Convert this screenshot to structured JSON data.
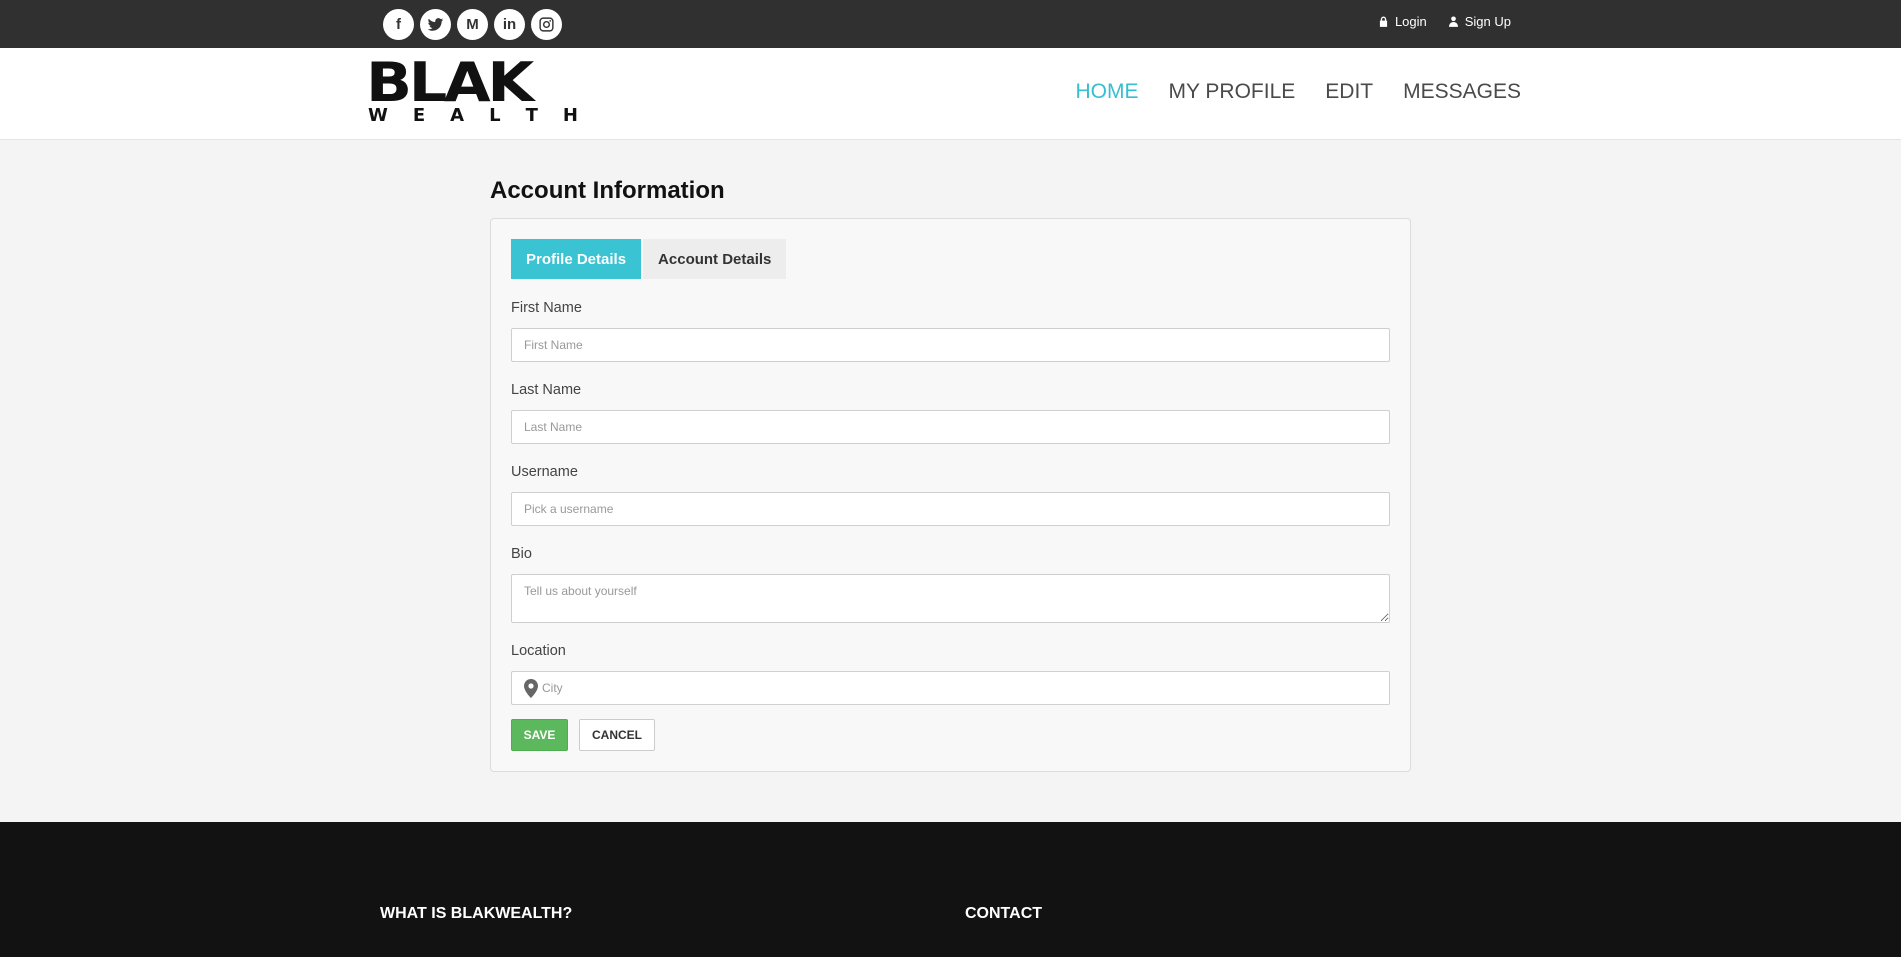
{
  "topbar": {
    "social": [
      {
        "icon": "facebook-icon",
        "glyph": "f"
      },
      {
        "icon": "twitter-icon",
        "glyph": ""
      },
      {
        "icon": "medium-icon",
        "glyph": "M"
      },
      {
        "icon": "linkedin-icon",
        "glyph": "in"
      },
      {
        "icon": "instagram-icon",
        "glyph": ""
      }
    ],
    "login_label": "Login",
    "signup_label": "Sign Up"
  },
  "header": {
    "logo_top": "BLAK",
    "logo_bottom": [
      "W",
      "E",
      "A",
      "L",
      "T",
      "H"
    ],
    "nav": [
      "HOME",
      "MY PROFILE",
      "EDIT",
      "MESSAGES"
    ],
    "active_nav": "HOME"
  },
  "main": {
    "title": "Account Information",
    "tabs": [
      "Profile Details",
      "Account Details"
    ],
    "form": {
      "first_name_label": "First Name",
      "first_name_placeholder": "First Name",
      "last_name_label": "Last Name",
      "last_name_placeholder": "Last Name",
      "username_label": "Username",
      "username_placeholder": "Pick a username",
      "bio_label": "Bio",
      "bio_placeholder": "Tell us about yourself",
      "location_label": "Location",
      "location_placeholder": "City",
      "save_label": "SAVE",
      "cancel_label": "CANCEL"
    }
  },
  "footer": {
    "col1_title": "WHAT IS BLAKWEALTH?",
    "col2_title": "CONTACT"
  },
  "colors": {
    "accent": "#35bfcf",
    "save_green": "#5cb85c",
    "topbar": "#303030",
    "footer": "#121212"
  }
}
